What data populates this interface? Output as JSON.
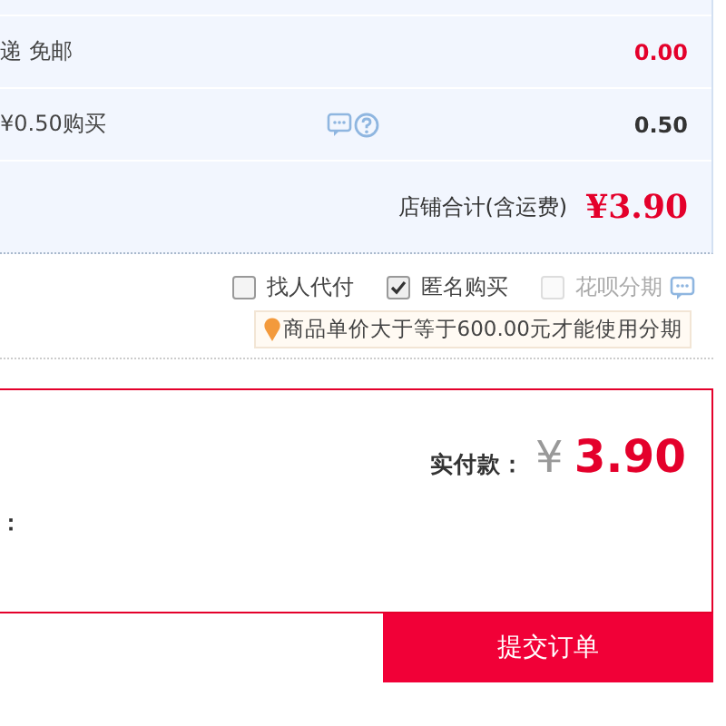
{
  "shop_panel": {
    "rows": [
      {
        "label": "递 免邮",
        "amount": "0.00",
        "highlight": true,
        "icons": false
      },
      {
        "label": "¥0.50购买",
        "amount": "0.50",
        "highlight": false,
        "icons": true
      }
    ],
    "total_label": "店铺合计(含运费)",
    "total": "¥3.90"
  },
  "options": [
    {
      "label": "找人代付",
      "checked": false,
      "disabled": false,
      "help": false
    },
    {
      "label": "匿名购买",
      "checked": true,
      "disabled": false,
      "help": false
    },
    {
      "label": "花呗分期",
      "checked": false,
      "disabled": true,
      "help": true
    }
  ],
  "installment_note": "商品单价大于等于600.00元才能使用分期",
  "payment": {
    "label": "实付款：",
    "currency": "¥",
    "amount": "3.90",
    "side_label": "："
  },
  "submit_button": "提交订单"
}
